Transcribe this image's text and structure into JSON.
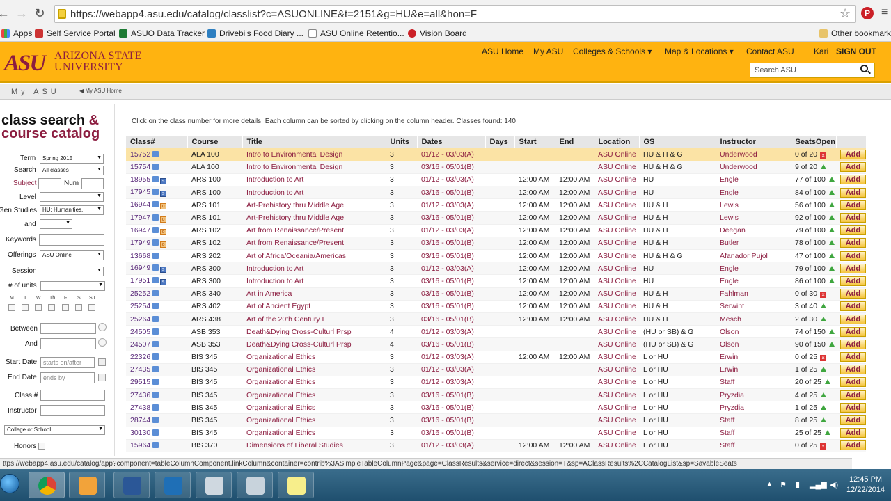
{
  "browser": {
    "url": "https://webapp4.asu.edu/catalog/classlist?c=ASUONLINE&t=2151&g=HU&e=all&hon=F",
    "bookmarks": [
      "Apps",
      "Self Service Portal",
      "ASUO Data Tracker",
      "Drivebi's Food Diary ...",
      "ASU Online Retentio...",
      "Vision Board"
    ],
    "other_bookmarks": "Other bookmarks"
  },
  "header": {
    "logo": "ASU",
    "name_line1": "ARIZONA STATE",
    "name_line2": "UNIVERSITY",
    "nav": [
      "ASU Home",
      "My ASU",
      "Colleges & Schools ▾",
      "Map & Locations ▾",
      "Contact ASU"
    ],
    "user": "Kari",
    "signout": "SIGN OUT",
    "search_placeholder": "Search ASU",
    "myasu": "My ASU",
    "myasu_home": "◀ My ASU Home"
  },
  "sidebar": {
    "title_part1": "class search ",
    "title_amp": "&",
    "title_part2": "course catalog",
    "term_label": "Term",
    "term_value": "Spring 2015",
    "search_label": "Search",
    "search_value": "All classes",
    "subject_label": "Subject",
    "num_label": "Num",
    "level_label": "Level",
    "gen_studies_label": "Gen Studies",
    "gen_studies_value": "HU: Humanities,",
    "and_label": "and",
    "keywords_label": "Keywords",
    "offerings_label": "Offerings",
    "offerings_value": "ASU Online",
    "session_label": "Session",
    "units_label": "# of units",
    "days": [
      "M",
      "T",
      "W",
      "Th",
      "F",
      "S",
      "Su"
    ],
    "between_label": "Between",
    "and2_label": "And",
    "start_date_label": "Start Date",
    "start_date_placeholder": "starts on/after",
    "end_date_label": "End Date",
    "end_date_placeholder": "ends by",
    "class_num_label": "Class #",
    "instructor_label": "Instructor",
    "college_value": "College or School",
    "honors_label": "Honors"
  },
  "main": {
    "info": "Click on the class number for more details.  Each column can be sorted by clicking on the column header. Classes found: 140",
    "columns": [
      "Class#",
      "Course",
      "Title",
      "Units",
      "Dates",
      "Days",
      "Start",
      "End",
      "Location",
      "GS",
      "Instructor",
      "SeatsOpen",
      ""
    ],
    "add_label": "Add",
    "rows": [
      {
        "num": "15752",
        "course": "ALA 100",
        "title": "Intro to Environmental Design",
        "units": "3",
        "dates": "01/12 - 03/03(A)",
        "start": "",
        "end": "",
        "loc": "ASU Online",
        "gs": "HU & H & G",
        "instr": "Underwood",
        "seats": "0 of 20",
        "full": true,
        "extra": ""
      },
      {
        "num": "15754",
        "course": "ALA 100",
        "title": "Intro to Environmental Design",
        "units": "3",
        "dates": "03/16 - 05/01(B)",
        "start": "",
        "end": "",
        "loc": "ASU Online",
        "gs": "HU & H & G",
        "instr": "Underwood",
        "seats": "9 of 20",
        "full": false,
        "extra": ""
      },
      {
        "num": "18955",
        "course": "ARS 100",
        "title": "Introduction to Art",
        "units": "3",
        "dates": "01/12 - 03/03(A)",
        "start": "12:00 AM",
        "end": "12:00 AM",
        "loc": "ASU Online",
        "gs": "HU",
        "instr": "Engle",
        "seats": "77 of 100",
        "full": false,
        "extra": "s"
      },
      {
        "num": "17945",
        "course": "ARS 100",
        "title": "Introduction to Art",
        "units": "3",
        "dates": "03/16 - 05/01(B)",
        "start": "12:00 AM",
        "end": "12:00 AM",
        "loc": "ASU Online",
        "gs": "HU",
        "instr": "Engle",
        "seats": "84 of 100",
        "full": false,
        "extra": "s"
      },
      {
        "num": "16944",
        "course": "ARS 101",
        "title": "Art-Prehistory thru Middle Age",
        "units": "3",
        "dates": "01/12 - 03/03(A)",
        "start": "12:00 AM",
        "end": "12:00 AM",
        "loc": "ASU Online",
        "gs": "HU & H",
        "instr": "Lewis",
        "seats": "56 of 100",
        "full": false,
        "extra": "o"
      },
      {
        "num": "17947",
        "course": "ARS 101",
        "title": "Art-Prehistory thru Middle Age",
        "units": "3",
        "dates": "03/16 - 05/01(B)",
        "start": "12:00 AM",
        "end": "12:00 AM",
        "loc": "ASU Online",
        "gs": "HU & H",
        "instr": "Lewis",
        "seats": "92 of 100",
        "full": false,
        "extra": "o"
      },
      {
        "num": "16947",
        "course": "ARS 102",
        "title": "Art from Renaissance/Present",
        "units": "3",
        "dates": "01/12 - 03/03(A)",
        "start": "12:00 AM",
        "end": "12:00 AM",
        "loc": "ASU Online",
        "gs": "HU & H",
        "instr": "Deegan",
        "seats": "79 of 100",
        "full": false,
        "extra": "o"
      },
      {
        "num": "17949",
        "course": "ARS 102",
        "title": "Art from Renaissance/Present",
        "units": "3",
        "dates": "03/16 - 05/01(B)",
        "start": "12:00 AM",
        "end": "12:00 AM",
        "loc": "ASU Online",
        "gs": "HU & H",
        "instr": "Butler",
        "seats": "78 of 100",
        "full": false,
        "extra": "o"
      },
      {
        "num": "13668",
        "course": "ARS 202",
        "title": "Art of Africa/Oceania/Americas",
        "units": "3",
        "dates": "03/16 - 05/01(B)",
        "start": "12:00 AM",
        "end": "12:00 AM",
        "loc": "ASU Online",
        "gs": "HU & H & G",
        "instr": "Afanador Pujol",
        "seats": "47 of 100",
        "full": false,
        "extra": ""
      },
      {
        "num": "16949",
        "course": "ARS 300",
        "title": "Introduction to Art",
        "units": "3",
        "dates": "01/12 - 03/03(A)",
        "start": "12:00 AM",
        "end": "12:00 AM",
        "loc": "ASU Online",
        "gs": "HU",
        "instr": "Engle",
        "seats": "79 of 100",
        "full": false,
        "extra": "s"
      },
      {
        "num": "17951",
        "course": "ARS 300",
        "title": "Introduction to Art",
        "units": "3",
        "dates": "03/16 - 05/01(B)",
        "start": "12:00 AM",
        "end": "12:00 AM",
        "loc": "ASU Online",
        "gs": "HU",
        "instr": "Engle",
        "seats": "86 of 100",
        "full": false,
        "extra": "s"
      },
      {
        "num": "25252",
        "course": "ARS 340",
        "title": "Art in America",
        "units": "3",
        "dates": "03/16 - 05/01(B)",
        "start": "12:00 AM",
        "end": "12:00 AM",
        "loc": "ASU Online",
        "gs": "HU & H",
        "instr": "Fahlman",
        "seats": "0 of 30",
        "full": true,
        "extra": ""
      },
      {
        "num": "25254",
        "course": "ARS 402",
        "title": "Art of Ancient Egypt",
        "units": "3",
        "dates": "03/16 - 05/01(B)",
        "start": "12:00 AM",
        "end": "12:00 AM",
        "loc": "ASU Online",
        "gs": "HU & H",
        "instr": "Serwint",
        "seats": "3 of 40",
        "full": false,
        "extra": ""
      },
      {
        "num": "25264",
        "course": "ARS 438",
        "title": "Art of the 20th Century I",
        "units": "3",
        "dates": "03/16 - 05/01(B)",
        "start": "12:00 AM",
        "end": "12:00 AM",
        "loc": "ASU Online",
        "gs": "HU & H",
        "instr": "Mesch",
        "seats": "2 of 30",
        "full": false,
        "extra": ""
      },
      {
        "num": "24505",
        "course": "ASB 353",
        "title": "Death&Dying Cross-Culturl Prsp",
        "units": "4",
        "dates": "01/12 - 03/03(A)",
        "start": "",
        "end": "",
        "loc": "ASU Online",
        "gs": "(HU or SB) & G",
        "instr": "Olson",
        "seats": "74 of 150",
        "full": false,
        "extra": ""
      },
      {
        "num": "24507",
        "course": "ASB 353",
        "title": "Death&Dying Cross-Culturl Prsp",
        "units": "4",
        "dates": "03/16 - 05/01(B)",
        "start": "",
        "end": "",
        "loc": "ASU Online",
        "gs": "(HU or SB) & G",
        "instr": "Olson",
        "seats": "90 of 150",
        "full": false,
        "extra": ""
      },
      {
        "num": "22326",
        "course": "BIS 345",
        "title": "Organizational Ethics",
        "units": "3",
        "dates": "01/12 - 03/03(A)",
        "start": "12:00 AM",
        "end": "12:00 AM",
        "loc": "ASU Online",
        "gs": "L or HU",
        "instr": "Erwin",
        "seats": "0 of 25",
        "full": true,
        "extra": ""
      },
      {
        "num": "27435",
        "course": "BIS 345",
        "title": "Organizational Ethics",
        "units": "3",
        "dates": "01/12 - 03/03(A)",
        "start": "",
        "end": "",
        "loc": "ASU Online",
        "gs": "L or HU",
        "instr": "Erwin",
        "seats": "1 of 25",
        "full": false,
        "extra": ""
      },
      {
        "num": "29515",
        "course": "BIS 345",
        "title": "Organizational Ethics",
        "units": "3",
        "dates": "01/12 - 03/03(A)",
        "start": "",
        "end": "",
        "loc": "ASU Online",
        "gs": "L or HU",
        "instr": "Staff",
        "seats": "20 of 25",
        "full": false,
        "extra": ""
      },
      {
        "num": "27436",
        "course": "BIS 345",
        "title": "Organizational Ethics",
        "units": "3",
        "dates": "03/16 - 05/01(B)",
        "start": "",
        "end": "",
        "loc": "ASU Online",
        "gs": "L or HU",
        "instr": "Pryzdia",
        "seats": "4 of 25",
        "full": false,
        "extra": ""
      },
      {
        "num": "27438",
        "course": "BIS 345",
        "title": "Organizational Ethics",
        "units": "3",
        "dates": "03/16 - 05/01(B)",
        "start": "",
        "end": "",
        "loc": "ASU Online",
        "gs": "L or HU",
        "instr": "Pryzdia",
        "seats": "1 of 25",
        "full": false,
        "extra": ""
      },
      {
        "num": "28744",
        "course": "BIS 345",
        "title": "Organizational Ethics",
        "units": "3",
        "dates": "03/16 - 05/01(B)",
        "start": "",
        "end": "",
        "loc": "ASU Online",
        "gs": "L or HU",
        "instr": "Staff",
        "seats": "8 of 25",
        "full": false,
        "extra": ""
      },
      {
        "num": "30130",
        "course": "BIS 345",
        "title": "Organizational Ethics",
        "units": "3",
        "dates": "03/16 - 05/01(B)",
        "start": "",
        "end": "",
        "loc": "ASU Online",
        "gs": "L or HU",
        "instr": "Staff",
        "seats": "25 of 25",
        "full": false,
        "extra": ""
      },
      {
        "num": "15964",
        "course": "BIS 370",
        "title": "Dimensions of Liberal Studies",
        "units": "3",
        "dates": "01/12 - 03/03(A)",
        "start": "12:00 AM",
        "end": "12:00 AM",
        "loc": "ASU Online",
        "gs": "L or HU",
        "instr": "Staff",
        "seats": "0 of 25",
        "full": true,
        "extra": ""
      }
    ]
  },
  "status_bar": "ttps://webapp4.asu.edu/catalog/app?component=tableColumnComponent.linkColumn&container=contrib%3ASimpleTableColumnPage&page=ClassResults&service=direct&session=T&sp=AClassResults%2CCatalogList&sp=SavableSeats",
  "taskbar": {
    "time": "12:45 PM",
    "date": "12/22/2014"
  },
  "colors": {
    "asu_gold": "#ffb310",
    "asu_maroon": "#8c1d40",
    "highlight_row": "#fbe3a5"
  }
}
